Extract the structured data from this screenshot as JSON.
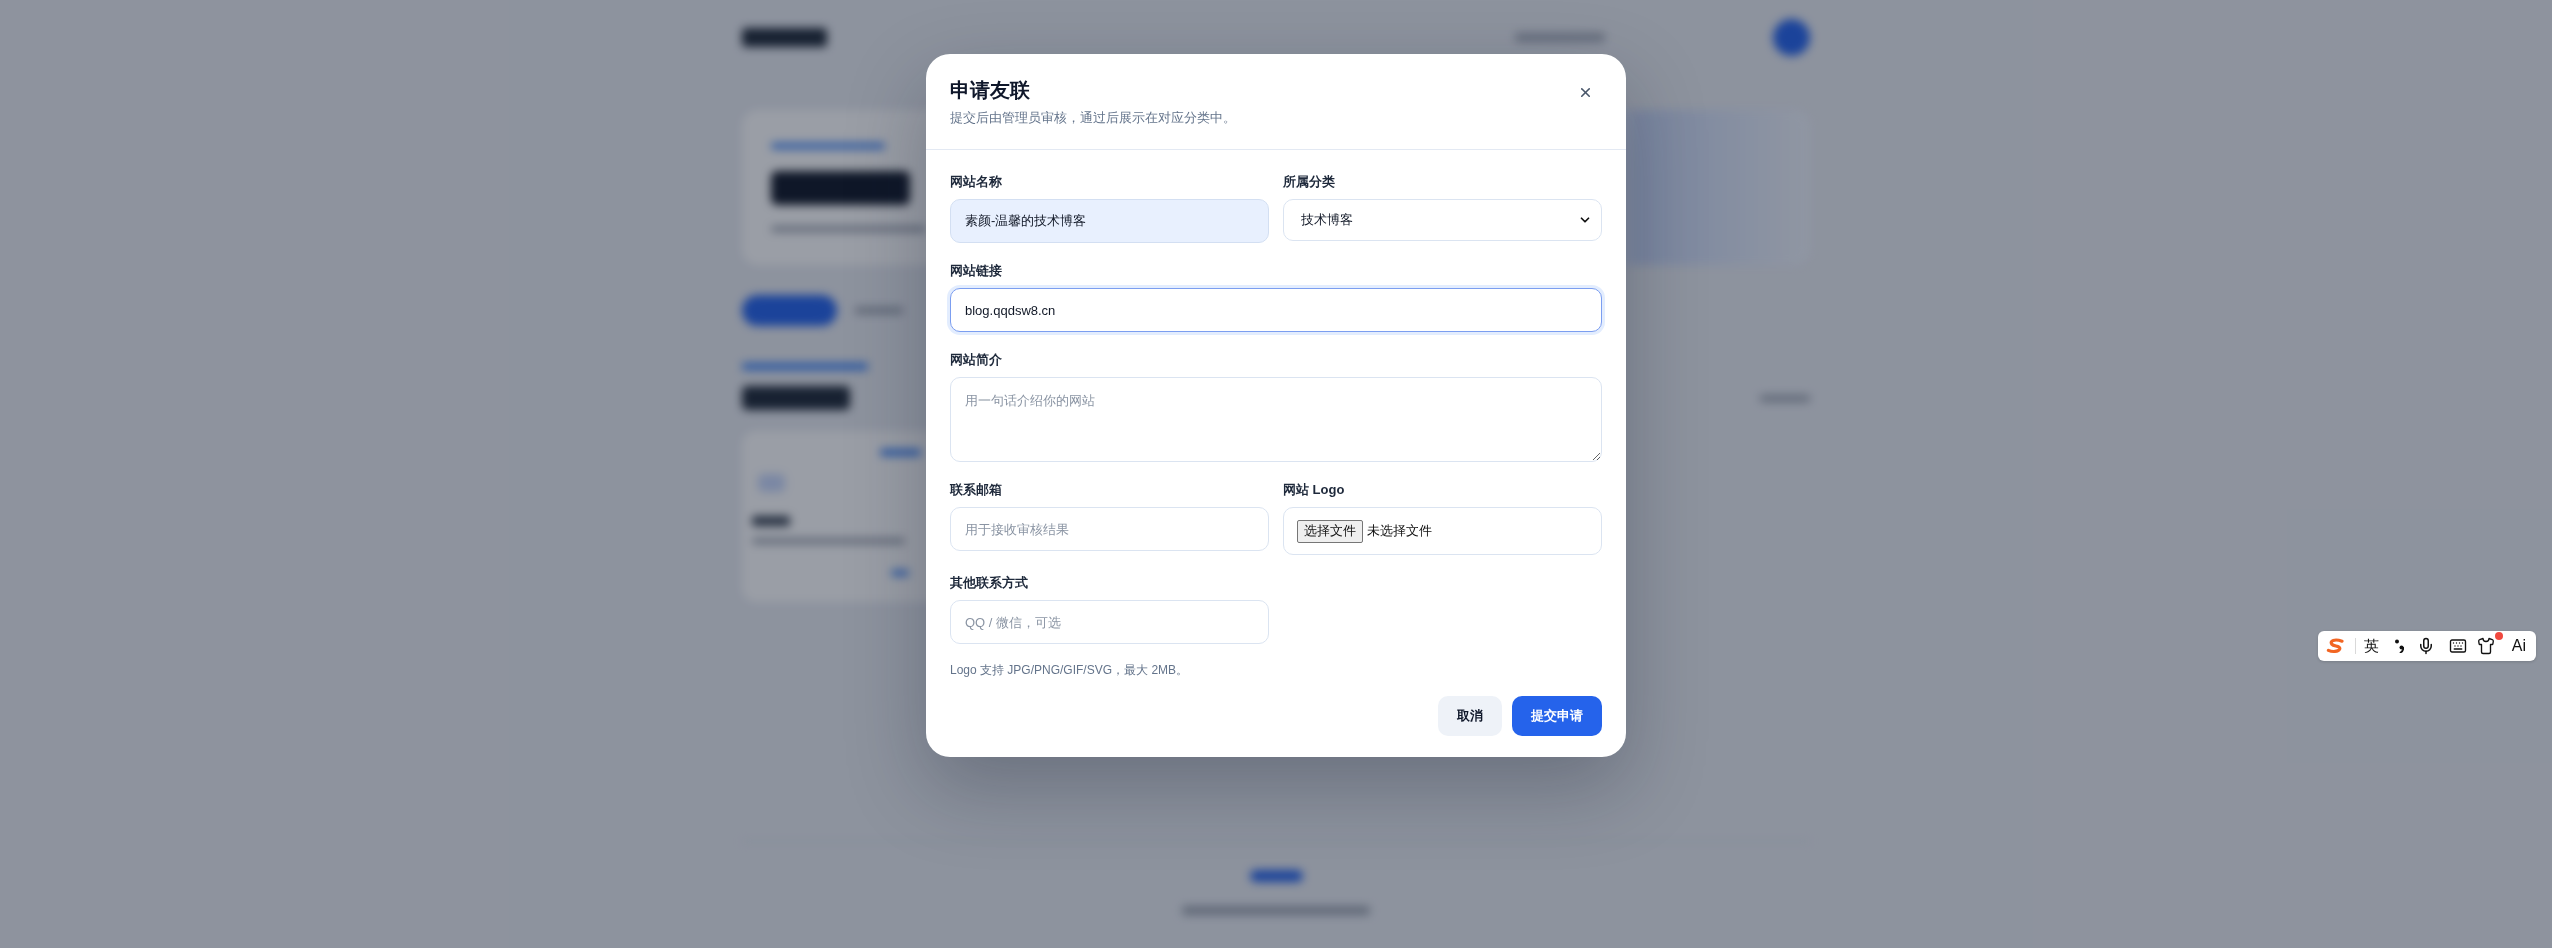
{
  "dialog": {
    "title": "申请友联",
    "subtitle": "提交后由管理员审核，通过后展示在对应分类中。",
    "fields": [
      {
        "kind": "text",
        "label": "网站名称",
        "value": "素颜-温馨的技术博客",
        "autofilled": true,
        "focused": false
      },
      {
        "kind": "select",
        "label": "所属分类",
        "value": "技术博客",
        "autofilled": false,
        "focused": false
      },
      {
        "kind": "url",
        "label": "网站链接",
        "value": "blog.qqdsw8.cn",
        "autofilled": false,
        "focused": true
      },
      {
        "kind": "textarea",
        "label": "网站简介",
        "placeholder": "用一句话介绍你的网站",
        "autofilled": false,
        "focused": false
      },
      {
        "kind": "email",
        "label": "联系邮箱",
        "placeholder": "用于接收审核结果",
        "autofilled": false,
        "focused": false
      },
      {
        "kind": "file",
        "label": "网站 Logo",
        "button": "选择文件",
        "status": "未选择文件",
        "autofilled": false,
        "focused": false
      },
      {
        "kind": "text",
        "label": "其他联系方式",
        "placeholder": "QQ / 微信，可选",
        "autofilled": false,
        "focused": false
      }
    ],
    "hint": "Logo 支持 JPG/PNG/GIF/SVG，最大 2MB。",
    "buttons": [
      {
        "kind": "secondary",
        "label": "取消"
      },
      {
        "kind": "primary",
        "label": "提交申请"
      }
    ]
  },
  "ime_toolbar": {
    "mode_label": "英",
    "ai_label": "Ai",
    "skin_badge": true
  }
}
